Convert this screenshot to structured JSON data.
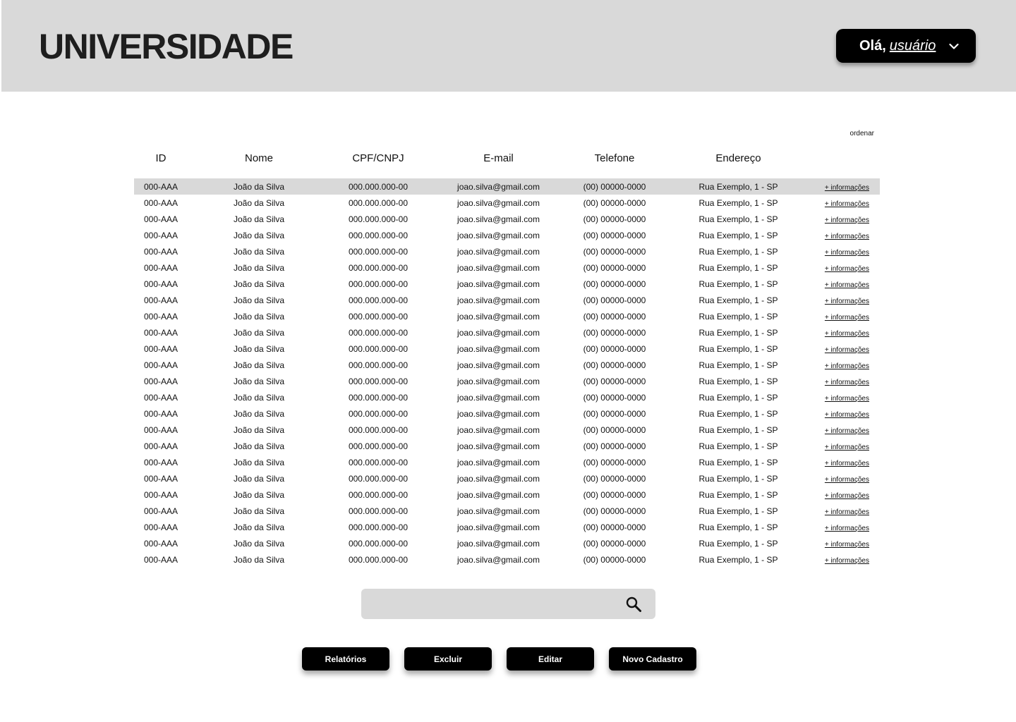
{
  "header": {
    "brand": "UNIVERSIDADE",
    "user_menu": {
      "greeting": "Olá,",
      "username": "usuário",
      "icon": "chevron-down-icon"
    }
  },
  "table": {
    "sort_label": "ordenar",
    "columns": [
      "ID",
      "Nome",
      "CPF/CNPJ",
      "E-mail",
      "Telefone",
      "Endereço"
    ],
    "rows": [
      {
        "id": "000-AAA",
        "nome": "João da Silva",
        "cpf": "000.000.000-00",
        "email": "joao.silva@gmail.com",
        "telefone": "(00) 00000-0000",
        "endereco": "Rua Exemplo, 1 - SP",
        "more": "+ informações",
        "selected": true
      },
      {
        "id": "000-AAA",
        "nome": "João da Silva",
        "cpf": "000.000.000-00",
        "email": "joao.silva@gmail.com",
        "telefone": "(00) 00000-0000",
        "endereco": "Rua Exemplo, 1 - SP",
        "more": "+ informações"
      },
      {
        "id": "000-AAA",
        "nome": "João da Silva",
        "cpf": "000.000.000-00",
        "email": "joao.silva@gmail.com",
        "telefone": "(00) 00000-0000",
        "endereco": "Rua Exemplo, 1 - SP",
        "more": "+ informações"
      },
      {
        "id": "000-AAA",
        "nome": "João da Silva",
        "cpf": "000.000.000-00",
        "email": "joao.silva@gmail.com",
        "telefone": "(00) 00000-0000",
        "endereco": "Rua Exemplo, 1 - SP",
        "more": "+ informações"
      },
      {
        "id": "000-AAA",
        "nome": "João da Silva",
        "cpf": "000.000.000-00",
        "email": "joao.silva@gmail.com",
        "telefone": "(00) 00000-0000",
        "endereco": "Rua Exemplo, 1 - SP",
        "more": "+ informações"
      },
      {
        "id": "000-AAA",
        "nome": "João da Silva",
        "cpf": "000.000.000-00",
        "email": "joao.silva@gmail.com",
        "telefone": "(00) 00000-0000",
        "endereco": "Rua Exemplo, 1 - SP",
        "more": "+ informações"
      },
      {
        "id": "000-AAA",
        "nome": "João da Silva",
        "cpf": "000.000.000-00",
        "email": "joao.silva@gmail.com",
        "telefone": "(00) 00000-0000",
        "endereco": "Rua Exemplo, 1 - SP",
        "more": "+ informações"
      },
      {
        "id": "000-AAA",
        "nome": "João da Silva",
        "cpf": "000.000.000-00",
        "email": "joao.silva@gmail.com",
        "telefone": "(00) 00000-0000",
        "endereco": "Rua Exemplo, 1 - SP",
        "more": "+ informações"
      },
      {
        "id": "000-AAA",
        "nome": "João da Silva",
        "cpf": "000.000.000-00",
        "email": "joao.silva@gmail.com",
        "telefone": "(00) 00000-0000",
        "endereco": "Rua Exemplo, 1 - SP",
        "more": "+ informações"
      },
      {
        "id": "000-AAA",
        "nome": "João da Silva",
        "cpf": "000.000.000-00",
        "email": "joao.silva@gmail.com",
        "telefone": "(00) 00000-0000",
        "endereco": "Rua Exemplo, 1 - SP",
        "more": "+ informações"
      },
      {
        "id": "000-AAA",
        "nome": "João da Silva",
        "cpf": "000.000.000-00",
        "email": "joao.silva@gmail.com",
        "telefone": "(00) 00000-0000",
        "endereco": "Rua Exemplo, 1 - SP",
        "more": "+ informações"
      },
      {
        "id": "000-AAA",
        "nome": "João da Silva",
        "cpf": "000.000.000-00",
        "email": "joao.silva@gmail.com",
        "telefone": "(00) 00000-0000",
        "endereco": "Rua Exemplo, 1 - SP",
        "more": "+ informações"
      },
      {
        "id": "000-AAA",
        "nome": "João da Silva",
        "cpf": "000.000.000-00",
        "email": "joao.silva@gmail.com",
        "telefone": "(00) 00000-0000",
        "endereco": "Rua Exemplo, 1 - SP",
        "more": "+ informações"
      },
      {
        "id": "000-AAA",
        "nome": "João da Silva",
        "cpf": "000.000.000-00",
        "email": "joao.silva@gmail.com",
        "telefone": "(00) 00000-0000",
        "endereco": "Rua Exemplo, 1 - SP",
        "more": "+ informações"
      },
      {
        "id": "000-AAA",
        "nome": "João da Silva",
        "cpf": "000.000.000-00",
        "email": "joao.silva@gmail.com",
        "telefone": "(00) 00000-0000",
        "endereco": "Rua Exemplo, 1 - SP",
        "more": "+ informações"
      },
      {
        "id": "000-AAA",
        "nome": "João da Silva",
        "cpf": "000.000.000-00",
        "email": "joao.silva@gmail.com",
        "telefone": "(00) 00000-0000",
        "endereco": "Rua Exemplo, 1 - SP",
        "more": "+ informações"
      },
      {
        "id": "000-AAA",
        "nome": "João da Silva",
        "cpf": "000.000.000-00",
        "email": "joao.silva@gmail.com",
        "telefone": "(00) 00000-0000",
        "endereco": "Rua Exemplo, 1 - SP",
        "more": "+ informações"
      },
      {
        "id": "000-AAA",
        "nome": "João da Silva",
        "cpf": "000.000.000-00",
        "email": "joao.silva@gmail.com",
        "telefone": "(00) 00000-0000",
        "endereco": "Rua Exemplo, 1 - SP",
        "more": "+ informações"
      },
      {
        "id": "000-AAA",
        "nome": "João da Silva",
        "cpf": "000.000.000-00",
        "email": "joao.silva@gmail.com",
        "telefone": "(00) 00000-0000",
        "endereco": "Rua Exemplo, 1 - SP",
        "more": "+ informações"
      },
      {
        "id": "000-AAA",
        "nome": "João da Silva",
        "cpf": "000.000.000-00",
        "email": "joao.silva@gmail.com",
        "telefone": "(00) 00000-0000",
        "endereco": "Rua Exemplo, 1 - SP",
        "more": "+ informações"
      },
      {
        "id": "000-AAA",
        "nome": "João da Silva",
        "cpf": "000.000.000-00",
        "email": "joao.silva@gmail.com",
        "telefone": "(00) 00000-0000",
        "endereco": "Rua Exemplo, 1 - SP",
        "more": "+ informações"
      },
      {
        "id": "000-AAA",
        "nome": "João da Silva",
        "cpf": "000.000.000-00",
        "email": "joao.silva@gmail.com",
        "telefone": "(00) 00000-0000",
        "endereco": "Rua Exemplo, 1 - SP",
        "more": "+ informações"
      },
      {
        "id": "000-AAA",
        "nome": "João da Silva",
        "cpf": "000.000.000-00",
        "email": "joao.silva@gmail.com",
        "telefone": "(00) 00000-0000",
        "endereco": "Rua Exemplo, 1 - SP",
        "more": "+ informações"
      },
      {
        "id": "000-AAA",
        "nome": "João da Silva",
        "cpf": "000.000.000-00",
        "email": "joao.silva@gmail.com",
        "telefone": "(00) 00000-0000",
        "endereco": "Rua Exemplo, 1 - SP",
        "more": "+ informações"
      }
    ]
  },
  "search": {
    "placeholder": "",
    "icon": "search-icon"
  },
  "actions": {
    "reports": "Relatórios",
    "delete": "Excluir",
    "edit": "Editar",
    "new_record": "Novo Cadastro"
  },
  "colors": {
    "header_bg": "#d9d9d9",
    "button_bg": "#000000",
    "selected_row": "#d9d9d9"
  }
}
